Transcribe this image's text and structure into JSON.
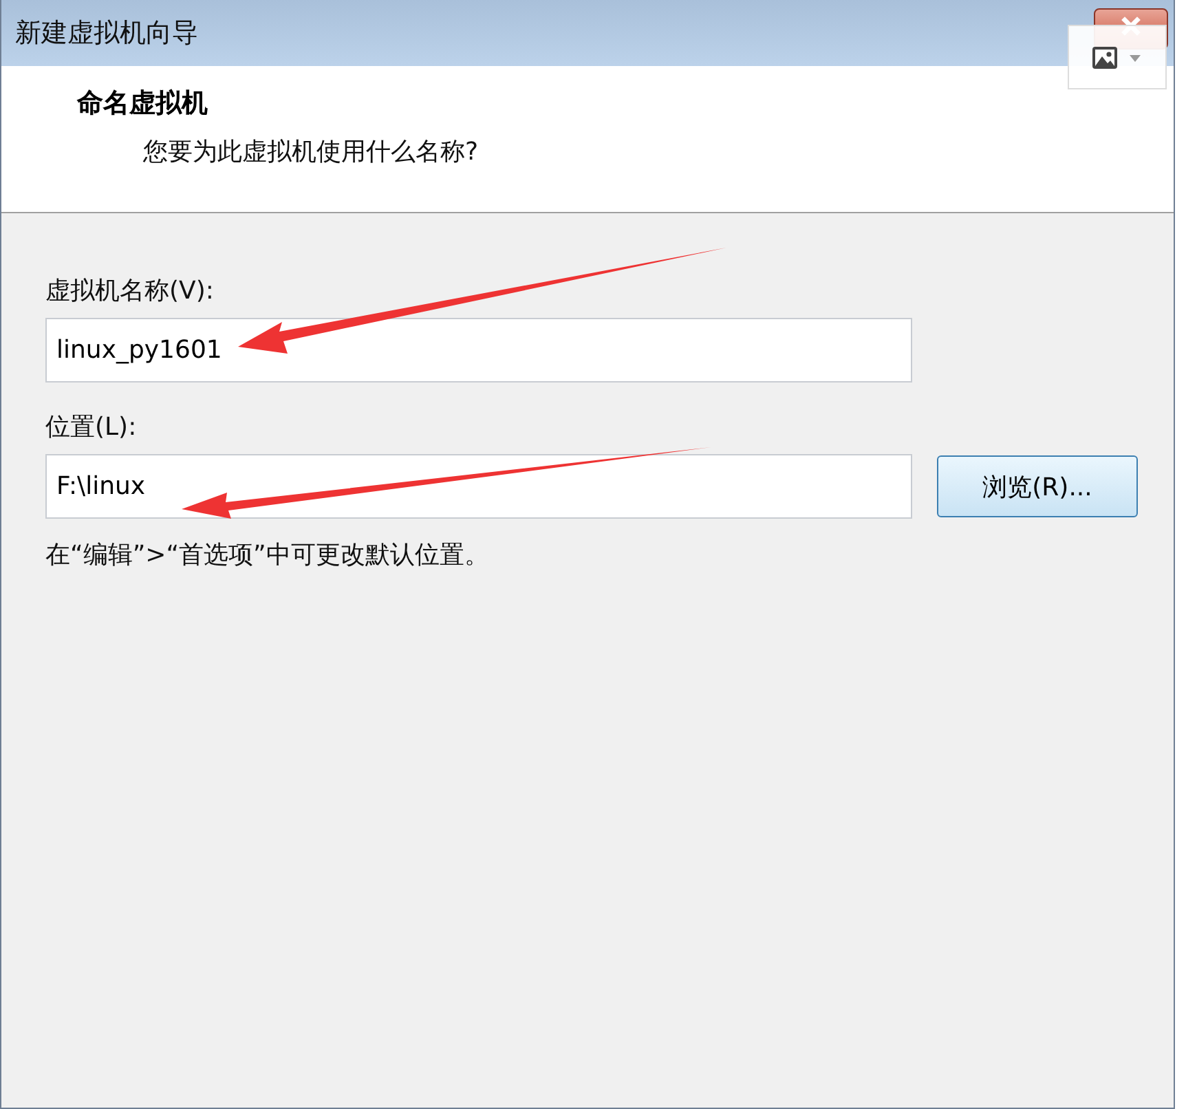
{
  "window": {
    "title": "新建虚拟机向导"
  },
  "header": {
    "title": "命名虚拟机",
    "subtitle": "您要为此虚拟机使用什么名称?"
  },
  "fields": [
    {
      "label": "虚拟机名称(V):",
      "value": "linux_py1601"
    },
    {
      "label": "位置(L):",
      "value": "F:\\linux",
      "button": "浏览(R)..."
    }
  ],
  "note": "在“编辑”>“首选项”中可更改默认位置。"
}
